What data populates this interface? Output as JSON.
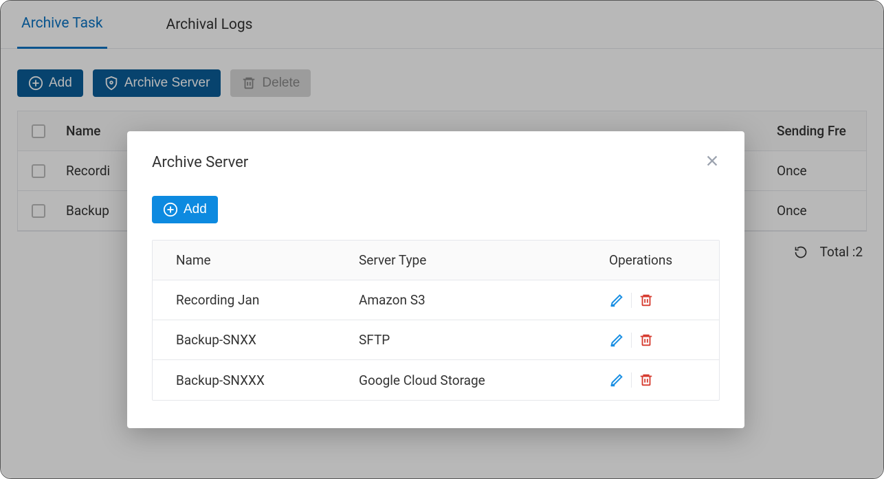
{
  "tabs": {
    "archive_task": "Archive Task",
    "archival_logs": "Archival Logs"
  },
  "toolbar": {
    "add": "Add",
    "archive_server": "Archive Server",
    "delete": "Delete"
  },
  "bg_table": {
    "headers": {
      "name": "Name",
      "sending_freq": "Sending Fre"
    },
    "rows": [
      {
        "name": "Recordi",
        "freq": "Once"
      },
      {
        "name": "Backup",
        "freq": "Once"
      }
    ]
  },
  "footer": {
    "total_label": "Total :2"
  },
  "modal": {
    "title": "Archive Server",
    "add": "Add",
    "headers": {
      "name": "Name",
      "type": "Server Type",
      "ops": "Operations"
    },
    "rows": [
      {
        "name": "Recording Jan",
        "type": "Amazon S3"
      },
      {
        "name": "Backup-SNXX",
        "type": "SFTP"
      },
      {
        "name": "Backup-SNXXX",
        "type": "Google Cloud Storage"
      }
    ]
  }
}
